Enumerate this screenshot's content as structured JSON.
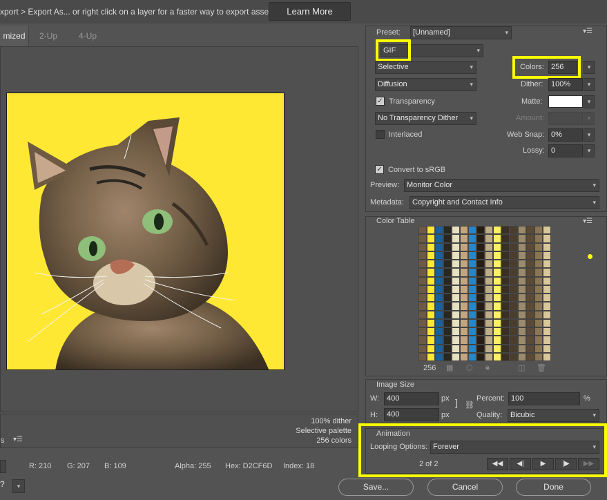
{
  "topbar": {
    "hint": "xport > Export As...  or right click on a layer for a faster way to export assets",
    "learn_more": "Learn More"
  },
  "tabs": [
    {
      "label": "mized",
      "active": true
    },
    {
      "label": "2-Up",
      "active": false
    },
    {
      "label": "4-Up",
      "active": false
    }
  ],
  "preview_info": {
    "dither": "100% dither",
    "palette": "Selective palette",
    "colors": "256 colors"
  },
  "status": {
    "menu_fragment": "s",
    "r": "R: 210",
    "g": "G: 207",
    "b": "B: 109",
    "alpha": "Alpha: 255",
    "hex": "Hex: D2CF6D",
    "index": "Index: 18"
  },
  "settings": {
    "preset_label": "Preset:",
    "preset_value": "[Unnamed]",
    "format": "GIF",
    "reduction": "Selective",
    "dither_algo": "Diffusion",
    "colors_label": "Colors:",
    "colors_value": "256",
    "dither_label": "Dither:",
    "dither_value": "100%",
    "transparency_label": "Transparency",
    "transparency_checked": true,
    "matte_label": "Matte:",
    "matte_color": "#ffffff",
    "transparency_dither": "No Transparency Dither",
    "amount_label": "Amount:",
    "interlaced_label": "Interlaced",
    "interlaced_checked": false,
    "websnap_label": "Web Snap:",
    "websnap_value": "0%",
    "lossy_label": "Lossy:",
    "lossy_value": "0",
    "convert_srgb_label": "Convert to sRGB",
    "convert_srgb_checked": true,
    "preview_label": "Preview:",
    "preview_value": "Monitor Color",
    "metadata_label": "Metadata:",
    "metadata_value": "Copyright and Contact Info"
  },
  "color_table": {
    "title": "Color Table",
    "count": "256",
    "swatches": [
      "#e8e1c0",
      "#c4a582",
      "#3a2f22",
      "#2a2620",
      "#6e5a43",
      "#ffe833",
      "#1f88d0",
      "#d8c79a",
      "#9c8b6a",
      "#5a4a36",
      "#1a5fa0",
      "#4b3d2c",
      "#bfae84",
      "#ffef63",
      "#8a7556",
      "#261e16"
    ]
  },
  "image_size": {
    "title": "Image Size",
    "w_label": "W:",
    "w_value": "400",
    "h_label": "H:",
    "h_value": "400",
    "unit": "px",
    "percent_label": "Percent:",
    "percent_value": "100",
    "percent_unit": "%",
    "quality_label": "Quality:",
    "quality_value": "Bicubic"
  },
  "animation": {
    "title": "Animation",
    "looping_label": "Looping Options:",
    "looping_value": "Forever",
    "frame_counter": "2 of 2"
  },
  "buttons": {
    "save": "Save...",
    "cancel": "Cancel",
    "done": "Done"
  },
  "colors": {
    "highlight": "#ffff00",
    "image_bg": "#ffe833"
  }
}
